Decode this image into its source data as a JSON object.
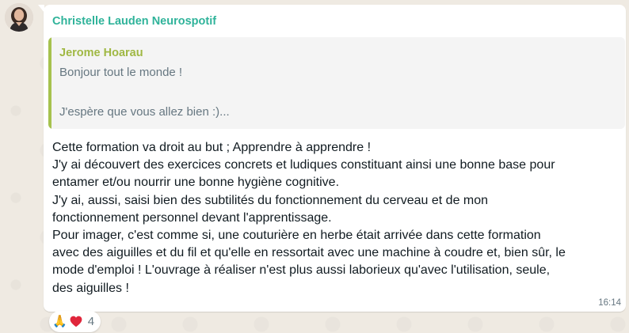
{
  "chat": {
    "sender_name": "Christelle Lauden Neurospotif",
    "quoted": {
      "author": "Jerome Hoarau",
      "line1": "Bonjour tout le monde !",
      "line2": "J'espère que vous allez bien :)..."
    },
    "message_lines": [
      "Cette formation va droit au but ; Apprendre à apprendre !",
      "J'y ai découvert des exercices concrets et ludiques constituant ainsi une bonne base pour",
      "entamer et/ou nourrir une bonne hygiène cognitive.",
      "J'y ai, aussi, saisi bien des subtilités du fonctionnement du cerveau et de mon",
      "fonctionnement personnel devant l'apprentissage.",
      "Pour imager, c'est comme si, une couturière en herbe était arrivée dans cette formation",
      "avec des aiguilles et du fil et qu'elle en ressortait avec une machine à coudre et, bien sûr, le",
      "mode d'emploi ! L'ouvrage à réaliser n'est plus aussi laborieux qu'avec l'utilisation, seule,",
      "des aiguilles !"
    ],
    "time": "16:14",
    "reactions": {
      "emojis": [
        "🙏",
        "❤️"
      ],
      "count": "4"
    }
  },
  "colors": {
    "sender": "#2fb39a",
    "quote_author": "#a0b844",
    "quote_bar": "#a6c24e",
    "chat_background": "#efeae2"
  },
  "icons": {
    "avatar": "profile-photo",
    "reaction_1": "folded-hands-icon",
    "reaction_2": "red-heart-icon"
  }
}
